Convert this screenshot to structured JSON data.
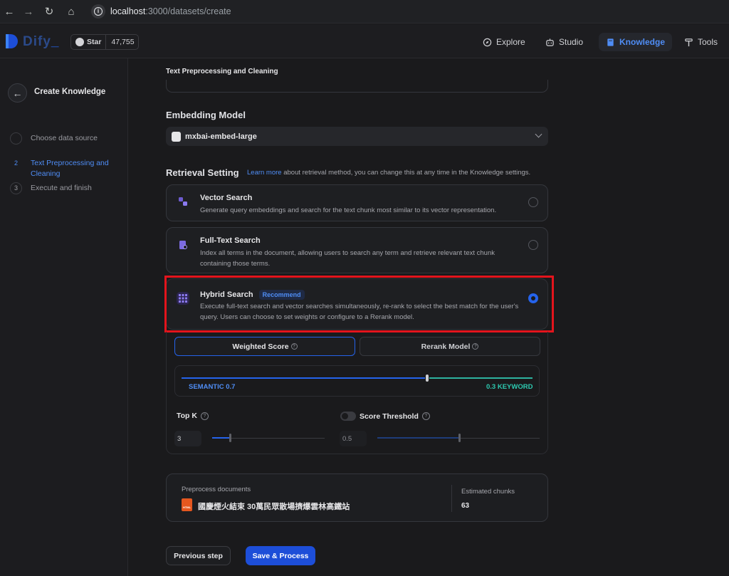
{
  "browser": {
    "url_host": "localhost",
    "url_rest": ":3000/datasets/create"
  },
  "header": {
    "logo_text": "Dify",
    "logo_suffix": "_",
    "star_label": "Star",
    "star_count": "47,755",
    "nav": [
      {
        "label": "Explore",
        "icon": "compass-icon",
        "active": false
      },
      {
        "label": "Studio",
        "icon": "robot-icon",
        "active": false
      },
      {
        "label": "Knowledge",
        "icon": "book-icon",
        "active": true
      },
      {
        "label": "Tools",
        "icon": "hammer-icon",
        "active": false
      }
    ]
  },
  "sidebar": {
    "title": "Create Knowledge",
    "steps": [
      {
        "num": "",
        "label": "Choose data source",
        "state": "done"
      },
      {
        "num": "2",
        "label": "Text Preprocessing and Cleaning",
        "state": "current"
      },
      {
        "num": "3",
        "label": "Execute and finish",
        "state": "upcoming"
      }
    ]
  },
  "main": {
    "section_title": "Text Preprocessing and Cleaning",
    "embedding": {
      "heading": "Embedding Model",
      "selected": "mxbai-embed-large"
    },
    "retrieval": {
      "heading": "Retrieval Setting",
      "learn_more": "Learn more",
      "note": " about retrieval method, you can change this at any time in the Knowledge settings.",
      "options": [
        {
          "title": "Vector Search",
          "badge": "",
          "desc": "Generate query embeddings and search for the text chunk most similar to its vector representation.",
          "selected": false
        },
        {
          "title": "Full-Text Search",
          "badge": "",
          "desc": "Index all terms in the document, allowing users to search any term and retrieve relevant text chunk containing those terms.",
          "selected": false
        },
        {
          "title": "Hybrid Search",
          "badge": "Recommend",
          "desc": "Execute full-text search and vector searches simultaneously, re-rank to select the best match for the user's query. Users can choose to set weights or configure to a Rerank model.",
          "selected": true
        }
      ],
      "tabs": [
        {
          "label": "Weighted Score",
          "active": true
        },
        {
          "label": "Rerank Model",
          "active": false
        }
      ],
      "weights": {
        "semantic_label": "SEMANTIC 0.7",
        "keyword_label": "0.3 KEYWORD",
        "semantic": 0.7
      },
      "top_k": {
        "label": "Top K",
        "value": "3",
        "level": 0.15
      },
      "score_threshold": {
        "label": "Score Threshold",
        "value": "0.5",
        "level": 0.5,
        "enabled": false
      }
    },
    "summary": {
      "preprocess_label": "Preprocess documents",
      "file_name": "國慶煙火結束 30萬民眾散場擠爆雲林高鐵站",
      "file_type": "HTML",
      "chunks_label": "Estimated chunks",
      "chunks_value": "63"
    },
    "buttons": {
      "previous": "Previous step",
      "save": "Save & Process"
    }
  }
}
